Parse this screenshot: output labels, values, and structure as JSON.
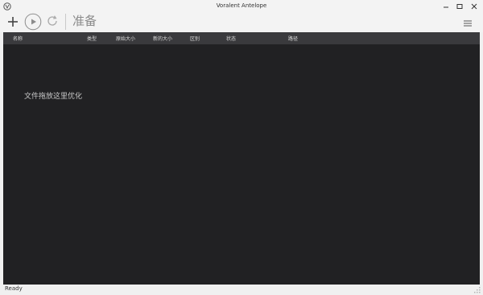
{
  "window": {
    "title": "Voralent Antelope",
    "controls": [
      "minimize-icon",
      "maximize-icon",
      "close-icon"
    ]
  },
  "toolbar": {
    "icons": [
      "plus-icon",
      "play-icon",
      "refresh-icon",
      "hamburger-menu-icon"
    ],
    "status_label": "准备"
  },
  "table": {
    "columns": [
      "名称",
      "类型",
      "原始大小",
      "新的大小",
      "区别",
      "状态",
      "路径"
    ],
    "rows": [],
    "empty_hint": "文件拖放这里优化"
  },
  "statusbar": {
    "text": "Ready"
  },
  "colors": {
    "table_background": "#212123",
    "header_background": "#3a3a3d",
    "chrome_background": "#f0f0f0"
  }
}
